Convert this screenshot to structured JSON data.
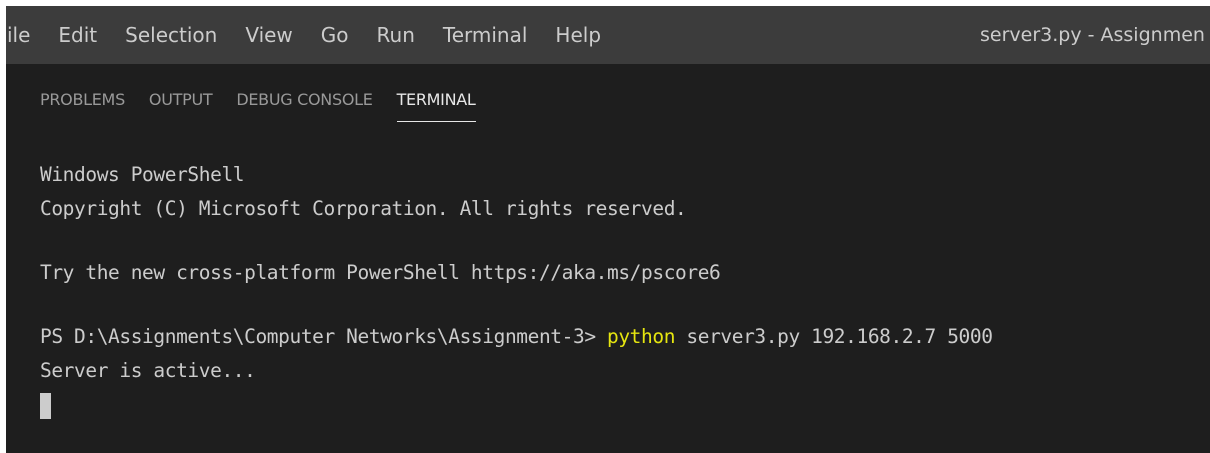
{
  "menubar": {
    "items": [
      {
        "label": "ile"
      },
      {
        "label": "Edit"
      },
      {
        "label": "Selection"
      },
      {
        "label": "View"
      },
      {
        "label": "Go"
      },
      {
        "label": "Run"
      },
      {
        "label": "Terminal"
      },
      {
        "label": "Help"
      }
    ],
    "window_title": "server3.py - Assignmen"
  },
  "panel": {
    "tabs": [
      {
        "label": "PROBLEMS",
        "active": false
      },
      {
        "label": "OUTPUT",
        "active": false
      },
      {
        "label": "DEBUG CONSOLE",
        "active": false
      },
      {
        "label": "TERMINAL",
        "active": true
      }
    ]
  },
  "terminal": {
    "line1": "Windows PowerShell",
    "line2": "Copyright (C) Microsoft Corporation. All rights reserved.",
    "line3": "Try the new cross-platform PowerShell https://aka.ms/pscore6",
    "prompt": "PS D:\\Assignments\\Computer Networks\\Assignment-3> ",
    "command": "python",
    "args": " server3.py 192.168.2.7 5000",
    "output": "Server is active..."
  },
  "colors": {
    "menubar_bg": "#3c3c3c",
    "panel_bg": "#1e1e1e",
    "command_highlight": "#e5e510",
    "text": "#cccccc"
  }
}
